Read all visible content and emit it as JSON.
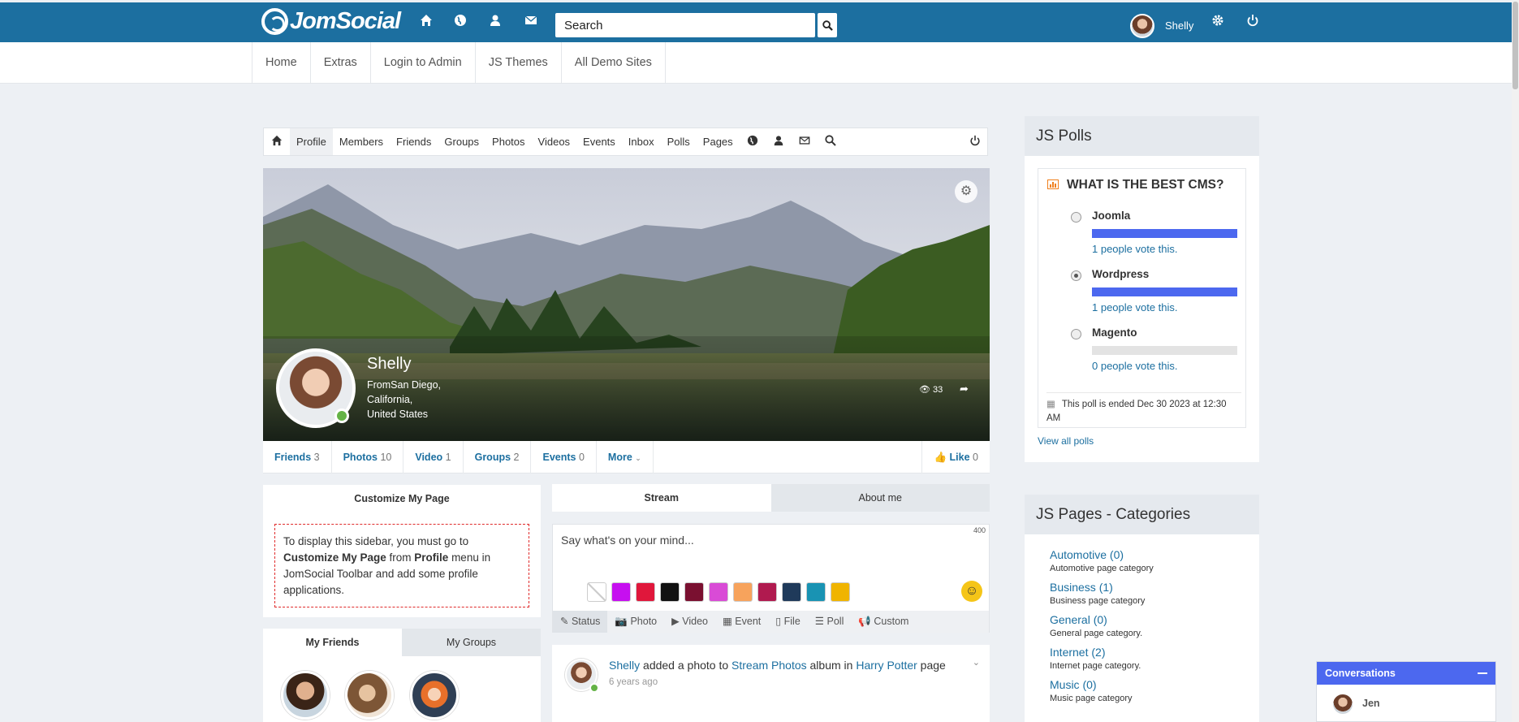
{
  "topbar": {
    "brand": "JomSocial",
    "search_placeholder": "Search",
    "user_name": "Shelly"
  },
  "mainnav": [
    "Home",
    "Extras",
    "Login to Admin",
    "JS Themes",
    "All Demo Sites"
  ],
  "toolbar": [
    "Profile",
    "Members",
    "Friends",
    "Groups",
    "Photos",
    "Videos",
    "Events",
    "Inbox",
    "Polls",
    "Pages"
  ],
  "profile": {
    "name": "Shelly",
    "location_line1": "FromSan Diego,",
    "location_line2": "California,",
    "location_line3": "United States",
    "views": "33"
  },
  "stats": [
    {
      "label": "Friends",
      "count": "3"
    },
    {
      "label": "Photos",
      "count": "10"
    },
    {
      "label": "Video",
      "count": "1"
    },
    {
      "label": "Groups",
      "count": "2"
    },
    {
      "label": "Events",
      "count": "0"
    }
  ],
  "stats_more": "More",
  "like": {
    "label": "Like",
    "count": "0"
  },
  "customize": {
    "title": "Customize My Page",
    "text1": "To display this sidebar, you must go to ",
    "bold1": "Customize My Page",
    "text2": " from ",
    "bold2": "Profile",
    "text3": " menu in JomSocial Toolbar and add some profile applications."
  },
  "friends_tabs": {
    "tab1": "My Friends",
    "tab2": "My Groups"
  },
  "stream_tabs": {
    "tab1": "Stream",
    "tab2": "About me"
  },
  "composer": {
    "placeholder": "Say what's on your mind...",
    "counter": "400",
    "tabs": [
      "Status",
      "Photo",
      "Video",
      "Event",
      "File",
      "Poll",
      "Custom"
    ],
    "swatch_colors": [
      "#ffffff",
      "#c60ff0",
      "#e0173b",
      "#111111",
      "#7a1030",
      "#d94bd6",
      "#f7a35c",
      "#b01a4f",
      "#1f3a5a",
      "#1993b3",
      "#f0b400"
    ]
  },
  "activity": {
    "actor": "Shelly",
    "verb1": " added a photo to ",
    "album": "Stream Photos",
    "verb2": " album in ",
    "page": "Harry Potter",
    "verb3": " page",
    "time": "6 years ago"
  },
  "polls": {
    "heading": "JS Polls",
    "question": "WHAT IS THE BEST CMS?",
    "options": [
      {
        "label": "Joomla",
        "votes": "1 people vote this.",
        "share": 1
      },
      {
        "label": "Wordpress",
        "votes": "1 people vote this.",
        "share": 1
      },
      {
        "label": "Magento",
        "votes": "0 people vote this.",
        "share": 0
      }
    ],
    "ended": "This poll is ended Dec 30 2023 at 12:30 AM",
    "view_all": "View all polls"
  },
  "pages": {
    "heading": "JS Pages - Categories",
    "categories": [
      {
        "name": "Automotive (0)",
        "desc": "Automotive page category"
      },
      {
        "name": "Business (1)",
        "desc": "Business page category"
      },
      {
        "name": "General (0)",
        "desc": "General page category."
      },
      {
        "name": "Internet (2)",
        "desc": "Internet page category."
      },
      {
        "name": "Music (0)",
        "desc": "Music page category"
      }
    ]
  },
  "conversations": {
    "title": "Conversations",
    "contact": "Jen"
  }
}
